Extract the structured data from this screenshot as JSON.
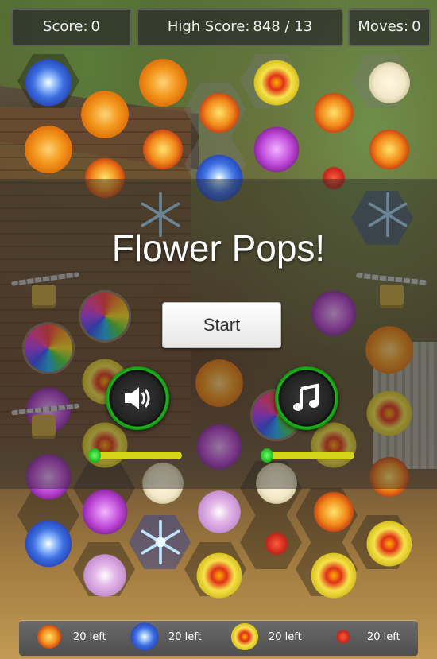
{
  "hud": {
    "score_label": "Score:",
    "score_value": "0",
    "high_label": "High Score:",
    "high_value": "848 / 13",
    "moves_label": "Moves:",
    "moves_value": "0"
  },
  "menu": {
    "title": "Flower Pops!",
    "start_label": "Start",
    "sound_icon": "speaker-icon",
    "music_icon": "music-note-icon",
    "sound_volume": 0.0,
    "music_volume": 0.0
  },
  "goals": [
    {
      "icon": "lily-icon",
      "text": "20 left"
    },
    {
      "icon": "blue-flower-icon",
      "text": "20 left"
    },
    {
      "icon": "yellow-flower-icon",
      "text": "20 left"
    },
    {
      "icon": "red-sprig-icon",
      "text": "20 left"
    }
  ],
  "colors": {
    "accent_green": "#1db81d",
    "slider_yellow": "#d4d41a"
  }
}
